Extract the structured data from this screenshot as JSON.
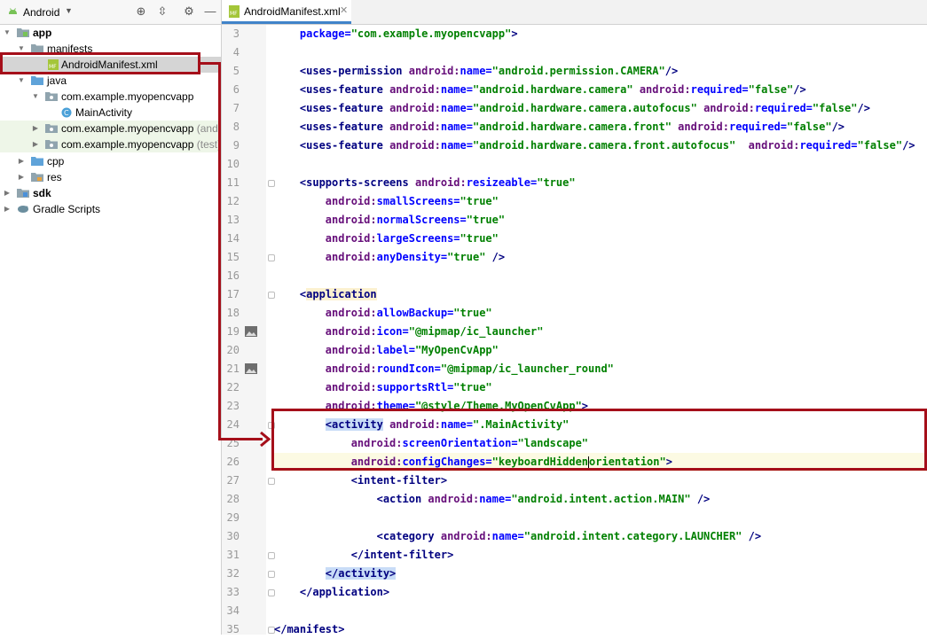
{
  "project_panel": {
    "view_selector": "Android",
    "tree": [
      {
        "label": "app",
        "bold": true
      },
      {
        "label": "manifests"
      },
      {
        "label": "AndroidManifest.xml",
        "selected": true
      },
      {
        "label": "java"
      },
      {
        "label": "com.example.myopencvapp"
      },
      {
        "label": "MainActivity"
      },
      {
        "label": "com.example.myopencvapp",
        "suffix": "(androidTest)"
      },
      {
        "label": "com.example.myopencvapp",
        "suffix": "(test)"
      },
      {
        "label": "cpp"
      },
      {
        "label": "res"
      },
      {
        "label": "sdk",
        "bold": true
      },
      {
        "label": "Gradle Scripts"
      }
    ]
  },
  "editor": {
    "tab_label": "AndroidManifest.xml",
    "line_numbers": [
      "3",
      "4",
      "5",
      "6",
      "7",
      "8",
      "9",
      "10",
      "11",
      "12",
      "13",
      "14",
      "15",
      "16",
      "17",
      "18",
      "19",
      "20",
      "21",
      "22",
      "23",
      "24",
      "25",
      "26",
      "27",
      "28",
      "29",
      "30",
      "31",
      "32",
      "33",
      "34",
      "35"
    ],
    "code": [
      [
        {
          "t": "    "
        },
        {
          "t": "package=",
          "c": "at"
        },
        {
          "t": "\"com.example.myopencvapp\"",
          "c": "sv"
        },
        {
          "t": ">",
          "c": "tg"
        }
      ],
      [],
      [
        {
          "t": "    "
        },
        {
          "t": "<uses-permission ",
          "c": "tg"
        },
        {
          "t": "android:",
          "c": "ns"
        },
        {
          "t": "name=",
          "c": "at"
        },
        {
          "t": "\"android.permission.CAMERA\"",
          "c": "sv"
        },
        {
          "t": "/>",
          "c": "tg"
        }
      ],
      [
        {
          "t": "    "
        },
        {
          "t": "<uses-feature ",
          "c": "tg"
        },
        {
          "t": "android:",
          "c": "ns"
        },
        {
          "t": "name=",
          "c": "at"
        },
        {
          "t": "\"android.hardware.camera\" ",
          "c": "sv"
        },
        {
          "t": "android:",
          "c": "ns"
        },
        {
          "t": "required=",
          "c": "at"
        },
        {
          "t": "\"false\"",
          "c": "sv"
        },
        {
          "t": "/>",
          "c": "tg"
        }
      ],
      [
        {
          "t": "    "
        },
        {
          "t": "<uses-feature ",
          "c": "tg"
        },
        {
          "t": "android:",
          "c": "ns"
        },
        {
          "t": "name=",
          "c": "at"
        },
        {
          "t": "\"android.hardware.camera.autofocus\" ",
          "c": "sv"
        },
        {
          "t": "android:",
          "c": "ns"
        },
        {
          "t": "required=",
          "c": "at"
        },
        {
          "t": "\"false\"",
          "c": "sv"
        },
        {
          "t": "/>",
          "c": "tg"
        }
      ],
      [
        {
          "t": "    "
        },
        {
          "t": "<uses-feature ",
          "c": "tg"
        },
        {
          "t": "android:",
          "c": "ns"
        },
        {
          "t": "name=",
          "c": "at"
        },
        {
          "t": "\"android.hardware.camera.front\" ",
          "c": "sv"
        },
        {
          "t": "android:",
          "c": "ns"
        },
        {
          "t": "required=",
          "c": "at"
        },
        {
          "t": "\"false\"",
          "c": "sv"
        },
        {
          "t": "/>",
          "c": "tg"
        }
      ],
      [
        {
          "t": "    "
        },
        {
          "t": "<uses-feature ",
          "c": "tg"
        },
        {
          "t": "android:",
          "c": "ns"
        },
        {
          "t": "name=",
          "c": "at"
        },
        {
          "t": "\"android.hardware.camera.front.autofocus\"  ",
          "c": "sv"
        },
        {
          "t": "android:",
          "c": "ns"
        },
        {
          "t": "required=",
          "c": "at"
        },
        {
          "t": "\"false\"",
          "c": "sv"
        },
        {
          "t": "/>",
          "c": "tg"
        }
      ],
      [],
      [
        {
          "t": "    "
        },
        {
          "t": "<supports-screens ",
          "c": "tg"
        },
        {
          "t": "android:",
          "c": "ns"
        },
        {
          "t": "resizeable=",
          "c": "at"
        },
        {
          "t": "\"true\"",
          "c": "sv"
        }
      ],
      [
        {
          "t": "        "
        },
        {
          "t": "android:",
          "c": "ns"
        },
        {
          "t": "smallScreens=",
          "c": "at"
        },
        {
          "t": "\"true\"",
          "c": "sv"
        }
      ],
      [
        {
          "t": "        "
        },
        {
          "t": "android:",
          "c": "ns"
        },
        {
          "t": "normalScreens=",
          "c": "at"
        },
        {
          "t": "\"true\"",
          "c": "sv"
        }
      ],
      [
        {
          "t": "        "
        },
        {
          "t": "android:",
          "c": "ns"
        },
        {
          "t": "largeScreens=",
          "c": "at"
        },
        {
          "t": "\"true\"",
          "c": "sv"
        }
      ],
      [
        {
          "t": "        "
        },
        {
          "t": "android:",
          "c": "ns"
        },
        {
          "t": "anyDensity=",
          "c": "at"
        },
        {
          "t": "\"true\" ",
          "c": "sv"
        },
        {
          "t": "/>",
          "c": "tg"
        }
      ],
      [],
      [
        {
          "t": "    "
        },
        {
          "t": "<",
          "c": "tg"
        },
        {
          "t": "application",
          "c": "tg appbg"
        }
      ],
      [
        {
          "t": "        "
        },
        {
          "t": "android:",
          "c": "ns"
        },
        {
          "t": "allowBackup=",
          "c": "at"
        },
        {
          "t": "\"true\"",
          "c": "sv"
        }
      ],
      [
        {
          "t": "        "
        },
        {
          "t": "android:",
          "c": "ns"
        },
        {
          "t": "icon=",
          "c": "at"
        },
        {
          "t": "\"@mipmap/ic_launcher\"",
          "c": "sv"
        }
      ],
      [
        {
          "t": "        "
        },
        {
          "t": "android:",
          "c": "ns"
        },
        {
          "t": "label=",
          "c": "at"
        },
        {
          "t": "\"MyOpenCvApp\"",
          "c": "sv"
        }
      ],
      [
        {
          "t": "        "
        },
        {
          "t": "android:",
          "c": "ns"
        },
        {
          "t": "roundIcon=",
          "c": "at"
        },
        {
          "t": "\"@mipmap/ic_launcher_round\"",
          "c": "sv"
        }
      ],
      [
        {
          "t": "        "
        },
        {
          "t": "android:",
          "c": "ns"
        },
        {
          "t": "supportsRtl=",
          "c": "at"
        },
        {
          "t": "\"true\"",
          "c": "sv"
        }
      ],
      [
        {
          "t": "        "
        },
        {
          "t": "android:",
          "c": "ns"
        },
        {
          "t": "theme=",
          "c": "at"
        },
        {
          "t": "\"@style/Theme.MyOpenCvApp\"",
          "c": "sv"
        },
        {
          "t": ">",
          "c": "tg"
        }
      ],
      [
        {
          "t": "        "
        },
        {
          "t": "<activity",
          "c": "tg matchbg"
        },
        {
          "t": " "
        },
        {
          "t": "android:",
          "c": "ns"
        },
        {
          "t": "name=",
          "c": "at"
        },
        {
          "t": "\".MainActivity\"",
          "c": "sv"
        }
      ],
      [
        {
          "t": "            "
        },
        {
          "t": "android:",
          "c": "ns"
        },
        {
          "t": "screenOrientation=",
          "c": "at"
        },
        {
          "t": "\"landscape\"",
          "c": "sv"
        }
      ],
      [
        {
          "t": "            "
        },
        {
          "t": "android:",
          "c": "ns"
        },
        {
          "t": "configChanges=",
          "c": "at"
        },
        {
          "t": "\"keyboardHidden",
          "c": "sv"
        },
        {
          "t": "",
          "caret": true
        },
        {
          "t": "orientation\"",
          "c": "sv"
        },
        {
          "t": ">",
          "c": "tg"
        }
      ],
      [
        {
          "t": "            "
        },
        {
          "t": "<intent-filter>",
          "c": "tg"
        }
      ],
      [
        {
          "t": "                "
        },
        {
          "t": "<action ",
          "c": "tg"
        },
        {
          "t": "android:",
          "c": "ns"
        },
        {
          "t": "name=",
          "c": "at"
        },
        {
          "t": "\"android.intent.action.MAIN\" ",
          "c": "sv"
        },
        {
          "t": "/>",
          "c": "tg"
        }
      ],
      [],
      [
        {
          "t": "                "
        },
        {
          "t": "<category ",
          "c": "tg"
        },
        {
          "t": "android:",
          "c": "ns"
        },
        {
          "t": "name=",
          "c": "at"
        },
        {
          "t": "\"android.intent.category.LAUNCHER\" ",
          "c": "sv"
        },
        {
          "t": "/>",
          "c": "tg"
        }
      ],
      [
        {
          "t": "            "
        },
        {
          "t": "</intent-filter>",
          "c": "tg"
        }
      ],
      [
        {
          "t": "        "
        },
        {
          "t": "</activity>",
          "c": "tg matchbg"
        }
      ],
      [
        {
          "t": "    "
        },
        {
          "t": "</application>",
          "c": "tg"
        }
      ],
      [],
      [
        {
          "t": "</manifest>",
          "c": "tg"
        }
      ]
    ]
  },
  "colors": {
    "annotation": "#a50f1a",
    "tag": "#000080",
    "namespace": "#660e7a",
    "attribute": "#0000ff",
    "string": "#008000"
  }
}
